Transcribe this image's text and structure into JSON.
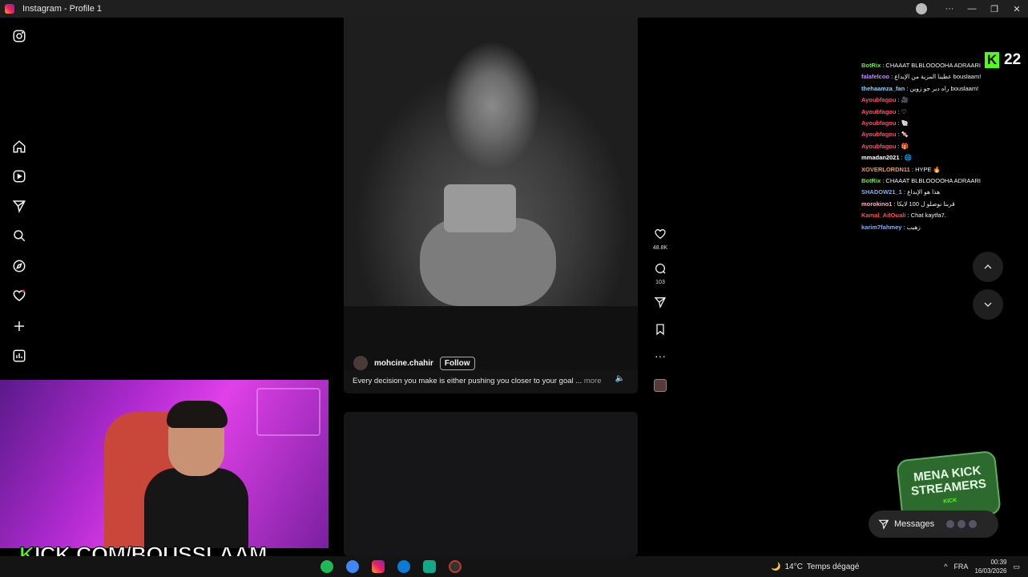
{
  "window": {
    "title": "Instagram - Profile 1",
    "controls": [
      "···",
      "—",
      "❐",
      "✕"
    ]
  },
  "sidebar": {
    "items": [
      {
        "name": "instagram-logo",
        "icon": "instagram-icon"
      },
      {
        "name": "home",
        "icon": "home-icon"
      },
      {
        "name": "reels",
        "icon": "reels-icon"
      },
      {
        "name": "direct",
        "icon": "send-icon"
      },
      {
        "name": "search",
        "icon": "search-icon"
      },
      {
        "name": "explore",
        "icon": "compass-icon"
      },
      {
        "name": "notifications",
        "icon": "heart-icon"
      },
      {
        "name": "create",
        "icon": "plus-icon"
      },
      {
        "name": "dashboard",
        "icon": "chart-icon"
      }
    ]
  },
  "post": {
    "username": "mohcine.chahir",
    "follow_label": "Follow",
    "caption": "Every decision you make is either pushing you closer to your goal ...",
    "more_label": "more",
    "likes": "48.8K",
    "comments": "103"
  },
  "scroll": {
    "up": "scroll-up",
    "down": "scroll-down"
  },
  "stream": {
    "viewer_count": "22",
    "kick_url_prefix": "K",
    "kick_url_rest": "ICK.COM/BOUSSLAAM",
    "mena_line1": "MENA KICK",
    "mena_line2": "STREAMERS",
    "mena_small": "KICK"
  },
  "chat": [
    {
      "user": "BotRix",
      "color": "#53fc18",
      "text": ": CHAAAT BLBLOOOOHA ADRAARI"
    },
    {
      "user": "falafelcoo",
      "color": "#c78cff",
      "text": ": عطينا المزية من الإبداع bouslaam!"
    },
    {
      "user": "thehaamza_fan",
      "color": "#7fd7ff",
      "text": ": راه دير جو زوين bouslaam!"
    },
    {
      "user": "Ayoubfagou",
      "color": "#ff4f6a",
      "text": ": 🎥"
    },
    {
      "user": "Ayoubfagou",
      "color": "#ff4f6a",
      "text": ": ♡"
    },
    {
      "user": "Ayoubfagou",
      "color": "#ff4f6a",
      "text": ": 🐚"
    },
    {
      "user": "Ayoubfagou",
      "color": "#ff4f6a",
      "text": ": 🍬"
    },
    {
      "user": "Ayoubfagou",
      "color": "#ff4f6a",
      "text": ": 🎁"
    },
    {
      "user": "mmadan2021",
      "color": "#ffffff",
      "text": ": 🌐"
    },
    {
      "user": "XOVERLORDN11",
      "color": "#ff9a3c",
      "text": ": HYPE 🔥"
    },
    {
      "user": "BotRix",
      "color": "#53fc18",
      "text": ": CHAAAT BLBLOOOOHA ADRAARI"
    },
    {
      "user": "SHADOW21_1",
      "color": "#7fb0ff",
      "text": ": هذا هو الإبداع"
    },
    {
      "user": "morokino1",
      "color": "#ffb3c1",
      "text": ": قربنا نوصلو ل 100 لايكا"
    },
    {
      "user": "Kamal_AitOuali",
      "color": "#ff4f4f",
      "text": ": Chat kaytfa7."
    },
    {
      "user": "karim7fahmey",
      "color": "#7fb0ff",
      "text": ": زهيب"
    }
  ],
  "messages": {
    "label": "Messages"
  },
  "taskbar": {
    "temperature": "14°C",
    "weather": "Temps dégagé",
    "lang": "FRA",
    "time": "00:39",
    "date": "16/03/2026"
  }
}
